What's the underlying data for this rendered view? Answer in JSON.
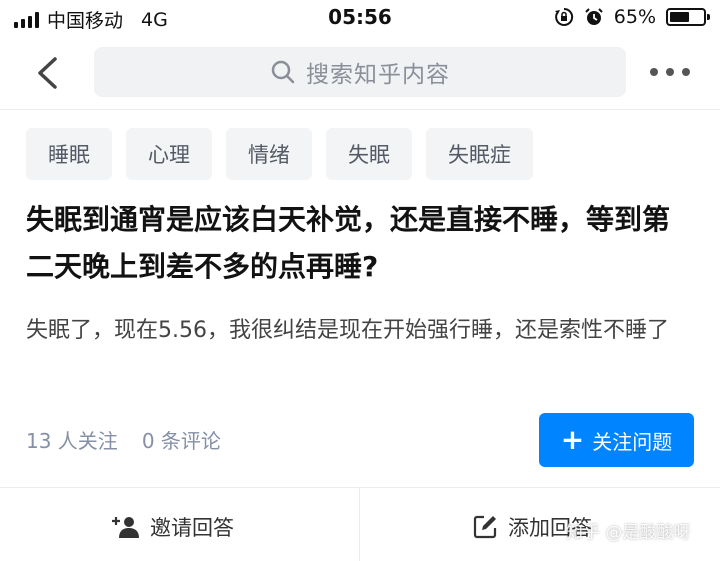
{
  "status_bar": {
    "carrier": "中国移动",
    "network": "4G",
    "time": "05:56",
    "battery_percent": "65%",
    "battery_level": 0.65
  },
  "nav": {
    "back_icon": "chevron-left-icon",
    "search_placeholder": "搜索知乎内容",
    "search_icon": "search-icon",
    "more_icon": "more-dots-icon"
  },
  "tags": [
    {
      "label": "睡眠"
    },
    {
      "label": "心理"
    },
    {
      "label": "情绪"
    },
    {
      "label": "失眠"
    },
    {
      "label": "失眠症"
    }
  ],
  "question": {
    "title": "失眠到通宵是应该白天补觉，还是直接不睡，等到第二天晚上到差不多的点再睡?",
    "detail": "失眠了，现在5.56，我很纠结是现在开始强行睡，还是索性不睡了"
  },
  "meta": {
    "followers": "13 人关注",
    "comments": "0 条评论"
  },
  "follow_button": {
    "icon": "plus-icon",
    "label": "关注问题",
    "color": "#0084ff"
  },
  "actions": {
    "invite_icon": "add-person-icon",
    "invite_label": "邀请回答",
    "answer_icon": "edit-icon",
    "answer_label": "添加回答"
  },
  "watermark": "知乎 @是酸酸呀"
}
